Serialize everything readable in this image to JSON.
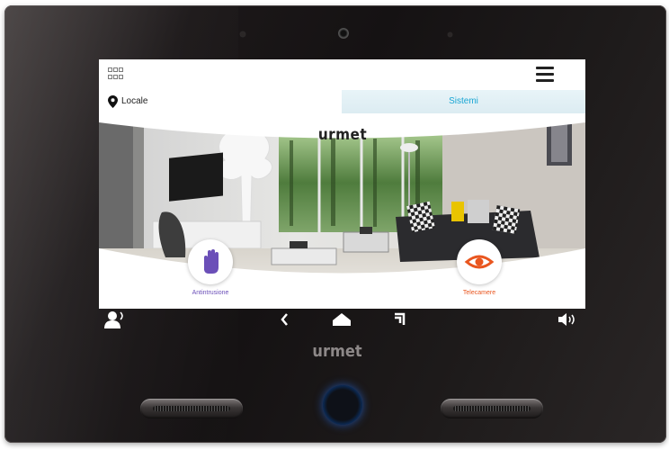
{
  "colors": {
    "accent_blue": "#19a6d4",
    "intrusion_purple": "#6b4fb8",
    "camera_orange": "#e9561f",
    "home_ring_blue": "#1d6fe0"
  },
  "header": {
    "apps_icon": "grid-icon",
    "menu_icon": "hamburger-menu-icon"
  },
  "tabs": {
    "local": {
      "label": "Locale",
      "icon": "location-pin-icon"
    },
    "sistemi": {
      "label": "Sistemi"
    }
  },
  "scene": {
    "brand": "urmet",
    "left_button": {
      "label": "Antintrusione",
      "icon": "hand-stop-icon"
    },
    "right_button": {
      "label": "Telecamere",
      "icon": "eye-icon"
    }
  },
  "navbar": {
    "items": [
      {
        "icon": "doorbell-person-icon"
      },
      {
        "icon": "chevron-left-icon"
      },
      {
        "icon": "home-icon"
      },
      {
        "icon": "recent-apps-icon"
      },
      {
        "icon": "speaker-volume-icon"
      }
    ]
  },
  "device": {
    "brand": "urmet"
  }
}
